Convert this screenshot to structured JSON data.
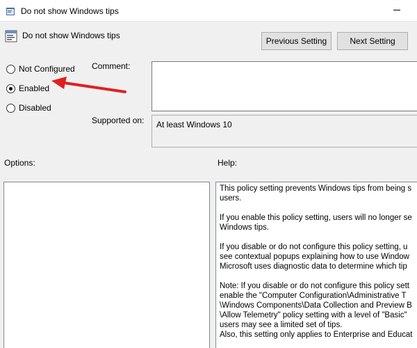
{
  "window": {
    "title": "Do not show Windows tips"
  },
  "header": {
    "policy_name": "Do not show Windows tips",
    "prev_button": "Previous Setting",
    "next_button": "Next Setting"
  },
  "state": {
    "options": [
      {
        "label": "Not Configured",
        "checked": false
      },
      {
        "label": "Enabled",
        "checked": true
      },
      {
        "label": "Disabled",
        "checked": false
      }
    ]
  },
  "comment": {
    "label": "Comment:",
    "value": ""
  },
  "supported": {
    "label": "Supported on:",
    "value": "At least Windows 10"
  },
  "options_panel": {
    "label": "Options:"
  },
  "help_panel": {
    "label": "Help:",
    "text": "This policy setting prevents Windows tips from being s\nusers.\n\nIf you enable this policy setting, users will no longer se\nWindows tips.\n\nIf you disable or do not configure this policy setting, u\nsee contextual popups explaining how to use Window\nMicrosoft uses diagnostic data to determine which tip\n\nNote: If you disable or do not configure this policy sett\nenable the \"Computer Configuration\\Administrative T\n\\Windows Components\\Data Collection and Preview B\n\\Allow Telemetry\" policy setting with a level of \"Basic\"\nusers may see a limited set of tips.\nAlso, this setting only applies to Enterprise and Educat"
  },
  "annotation": {
    "arrow_color": "#e02020"
  }
}
